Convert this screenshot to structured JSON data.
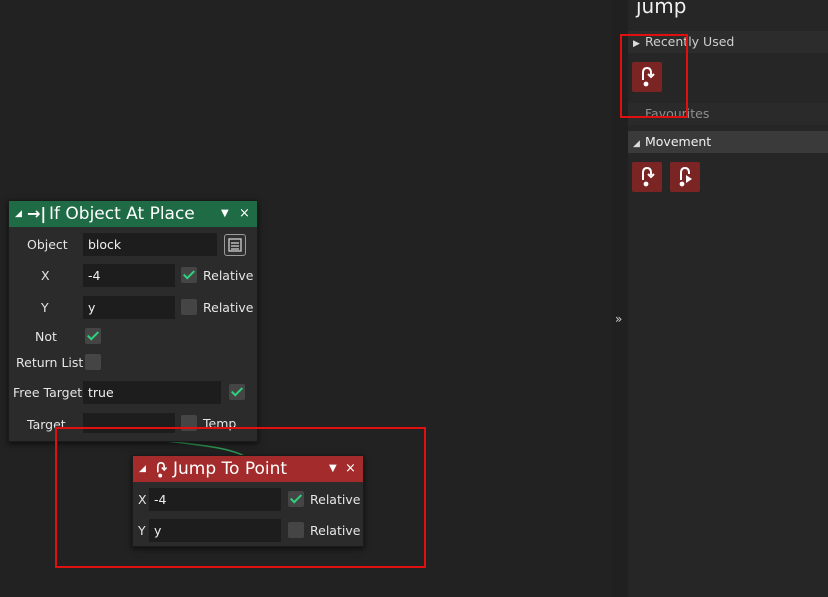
{
  "search": {
    "query": "jump"
  },
  "library": {
    "recently_used": "Recently Used",
    "favourites": "Favourites",
    "movement": "Movement",
    "arrow_collapsed": "▶",
    "arrow_expanded": "◢"
  },
  "splitter": {
    "label": "»"
  },
  "node_if": {
    "collapse": "◢",
    "icon": "→|",
    "title": "If Object At Place",
    "menu": "▼",
    "close": "×",
    "object_label": "Object",
    "object_value": "block",
    "x_label": "X",
    "x_value": "-4",
    "x_relative_label": "Relative",
    "x_relative": true,
    "y_label": "Y",
    "y_value": "y",
    "y_relative_label": "Relative",
    "y_relative": false,
    "not_label": "Not",
    "not_checked": true,
    "return_list_label": "Return List",
    "return_list_checked": false,
    "free_target_label": "Free Target",
    "free_target_value": "true",
    "free_target_checked": true,
    "target_label": "Target",
    "target_value": "",
    "temp_label": "Temp",
    "temp_checked": false
  },
  "node_jump": {
    "collapse": "◢",
    "title": "Jump To Point",
    "menu": "▼",
    "close": "×",
    "x_label": "X",
    "x_value": "-4",
    "x_relative_label": "Relative",
    "x_relative": true,
    "y_label": "Y",
    "y_value": "y",
    "y_relative_label": "Relative",
    "y_relative": false
  },
  "colors": {
    "canvas_bg": "#222222",
    "if_header": "#1e6b45",
    "jump_header": "#a32b2b",
    "action_icon": "#7a2524",
    "highlight": "#e01010",
    "check": "#2fd27e"
  }
}
